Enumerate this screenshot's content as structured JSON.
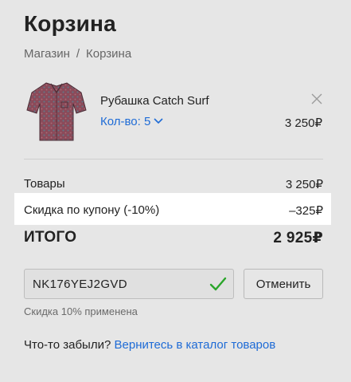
{
  "page": {
    "title": "Корзина",
    "breadcrumb": {
      "shop": "Магазин",
      "separator": "/",
      "current": "Корзина"
    }
  },
  "cart_item": {
    "name": "Рубашка Catch Surf",
    "quantity_label": "Кол-во: 5",
    "price": "3 250₽",
    "image_icon": "shirt-thumbnail"
  },
  "summary": {
    "goods_label": "Товары",
    "goods_value": "3 250₽",
    "coupon_label": "Скидка по купону (-10%)",
    "coupon_value": "–325₽",
    "total_label": "ИТОГО",
    "total_value": "2 925₽"
  },
  "coupon": {
    "code": "NK176YEJ2GVD",
    "cancel_label": "Отменить",
    "status": "Скидка 10% применена"
  },
  "footer": {
    "prompt": "Что-то забыли?",
    "link": "Вернитесь в каталог товаров"
  },
  "colors": {
    "background": "#e6e6e6",
    "highlight": "#ffffff",
    "link": "#1e6bd6",
    "check": "#2aa52a"
  }
}
